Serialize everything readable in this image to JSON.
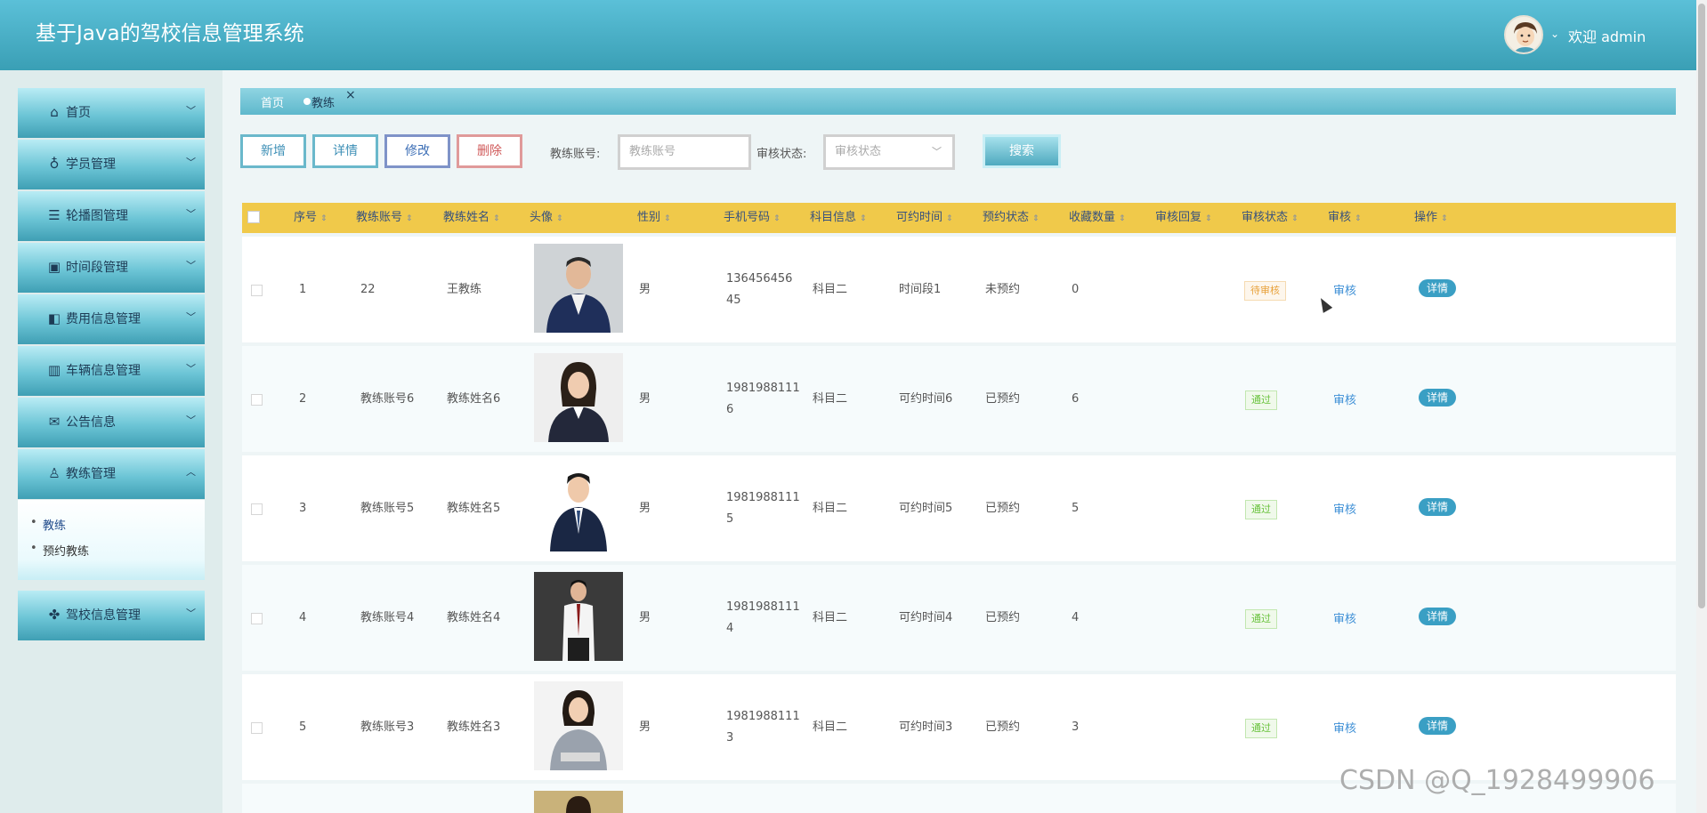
{
  "header": {
    "title": "基于Java的驾校信息管理系统",
    "welcome": "欢迎 admin"
  },
  "sidebar": {
    "items": [
      {
        "label": "首页",
        "icon": "home-icon"
      },
      {
        "label": "学员管理",
        "icon": "bulb-icon"
      },
      {
        "label": "轮播图管理",
        "icon": "list-icon"
      },
      {
        "label": "时间段管理",
        "icon": "calendar-icon"
      },
      {
        "label": "费用信息管理",
        "icon": "panel-icon"
      },
      {
        "label": "车辆信息管理",
        "icon": "chart-icon"
      },
      {
        "label": "公告信息",
        "icon": "mail-icon"
      },
      {
        "label": "教练管理",
        "icon": "user-icon"
      },
      {
        "label": "驾校信息管理",
        "icon": "grid-icon"
      }
    ],
    "submenu": [
      "教练",
      "预约教练"
    ]
  },
  "breadcrumb": {
    "home": "首页",
    "current": "教练",
    "close": "×"
  },
  "toolbar": {
    "add": "新增",
    "detail": "详情",
    "edit": "修改",
    "delete": "删除",
    "account_label": "教练账号:",
    "account_placeholder": "教练账号",
    "status_label": "审核状态:",
    "status_placeholder": "审核状态",
    "search": "搜索"
  },
  "table": {
    "columns": [
      "序号",
      "教练账号",
      "教练姓名",
      "头像",
      "性别",
      "手机号码",
      "科目信息",
      "可约时间",
      "预约状态",
      "收藏数量",
      "审核回复",
      "审核状态",
      "审核",
      "操作"
    ],
    "rows": [
      {
        "no": "1",
        "account": "22",
        "name": "王教练",
        "gender": "男",
        "phone1": "136456456",
        "phone2": "45",
        "subject": "科目二",
        "time": "时间段1",
        "booking": "未预约",
        "fav": "0",
        "reply": "",
        "status": "待审核",
        "audit": "审核",
        "action": "详情"
      },
      {
        "no": "2",
        "account": "教练账号6",
        "name": "教练姓名6",
        "gender": "男",
        "phone1": "1981988111",
        "phone2": "6",
        "subject": "科目二",
        "time": "可约时间6",
        "booking": "已预约",
        "fav": "6",
        "reply": "",
        "status": "通过",
        "audit": "审核",
        "action": "详情"
      },
      {
        "no": "3",
        "account": "教练账号5",
        "name": "教练姓名5",
        "gender": "男",
        "phone1": "1981988111",
        "phone2": "5",
        "subject": "科目二",
        "time": "可约时间5",
        "booking": "已预约",
        "fav": "5",
        "reply": "",
        "status": "通过",
        "audit": "审核",
        "action": "详情"
      },
      {
        "no": "4",
        "account": "教练账号4",
        "name": "教练姓名4",
        "gender": "男",
        "phone1": "1981988111",
        "phone2": "4",
        "subject": "科目二",
        "time": "可约时间4",
        "booking": "已预约",
        "fav": "4",
        "reply": "",
        "status": "通过",
        "audit": "审核",
        "action": "详情"
      },
      {
        "no": "5",
        "account": "教练账号3",
        "name": "教练姓名3",
        "gender": "男",
        "phone1": "1981988111",
        "phone2": "3",
        "subject": "科目二",
        "time": "可约时间3",
        "booking": "已预约",
        "fav": "3",
        "reply": "",
        "status": "通过",
        "audit": "审核",
        "action": "详情"
      }
    ]
  },
  "watermark": "CSDN @Q_1928499906",
  "colors": {
    "header": "#3a9fb5",
    "table_head": "#f0c94a",
    "pending": "#e8a13a",
    "pass": "#67c23a",
    "detail_button": "#3a9fc4"
  }
}
